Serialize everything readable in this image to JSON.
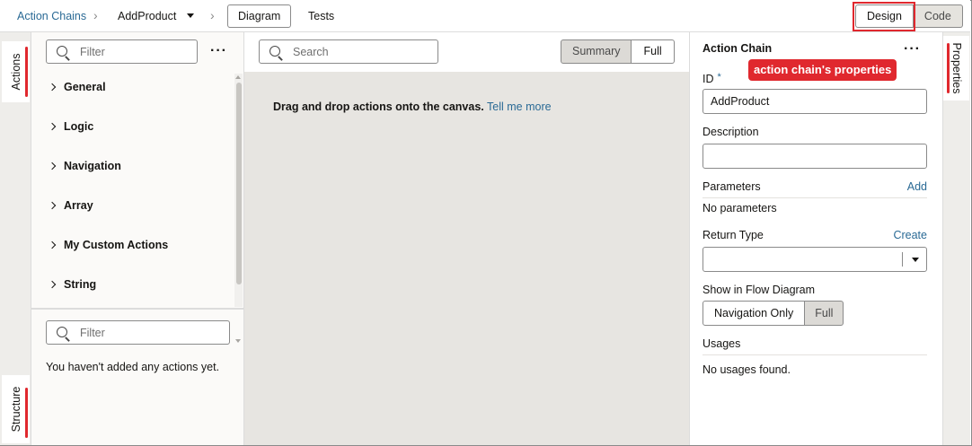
{
  "breadcrumb": {
    "root": "Action Chains",
    "current": "AddProduct",
    "separator": "›"
  },
  "top_tabs": {
    "diagram": "Diagram",
    "tests": "Tests"
  },
  "view_toggle": {
    "design": "Design",
    "code": "Code",
    "selected": "Design"
  },
  "left_tabs": {
    "actions": "Actions",
    "structure": "Structure"
  },
  "actions_panel": {
    "filter_placeholder": "Filter",
    "more": "···",
    "categories": [
      "General",
      "Logic",
      "Navigation",
      "Array",
      "My Custom Actions",
      "String"
    ],
    "lower_filter_placeholder": "Filter",
    "empty_message": "You haven't added any actions yet."
  },
  "canvas": {
    "search_placeholder": "Search",
    "mode_summary": "Summary",
    "mode_full": "Full",
    "selected_mode": "Summary",
    "hint_text": "Drag and drop actions onto the canvas.",
    "hint_link": "Tell me more"
  },
  "properties_panel": {
    "title": "Action Chain",
    "more": "···",
    "callout": "action chain's properties",
    "id_label": "ID",
    "id_required": "*",
    "id_value": "AddProduct",
    "description_label": "Description",
    "description_value": "",
    "parameters_label": "Parameters",
    "parameters_action": "Add",
    "parameters_empty": "No parameters",
    "return_type_label": "Return Type",
    "return_type_action": "Create",
    "return_type_value": "",
    "flow_label": "Show in Flow Diagram",
    "flow_option_a": "Navigation Only",
    "flow_option_b": "Full",
    "flow_selected": "Full",
    "usages_label": "Usages",
    "usages_empty": "No usages found."
  },
  "right_tabs": {
    "properties": "Properties"
  },
  "colors": {
    "accent_red": "#e0282e",
    "link_blue": "#2a6a95"
  }
}
